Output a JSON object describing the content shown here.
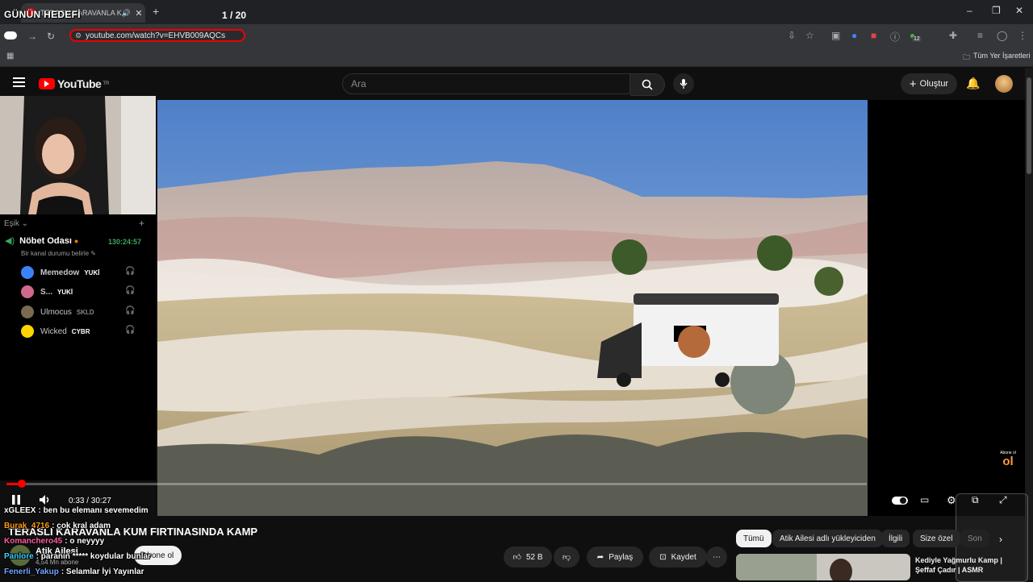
{
  "overlay": {
    "goal_title": "GÜNÜN HEDEFİ",
    "goal_counter": "1 / 20"
  },
  "browser": {
    "tab_title": "TERASLI KARAVANLA KUM",
    "url": "youtube.com/watch?v=EHVB009AQCs",
    "bookmarks_label": "Tüm Yer İşaretleri",
    "ext_badge": "12"
  },
  "youtube": {
    "logo_text": "YouTube",
    "logo_sup": "TR",
    "search_placeholder": "Ara",
    "create_label": "Oluştur"
  },
  "discord": {
    "section_label": "Eşik",
    "channel_name": "Nöbet Odası",
    "timer": "130:24:57",
    "status": "Bir kanal durumu belirle",
    "members": [
      {
        "name": "Memedow",
        "badge": "YUKİ",
        "color": "#3b82f6"
      },
      {
        "name": "S...",
        "badge": "YUKİ",
        "color": "#d06a8a"
      },
      {
        "name": "Ulmocus",
        "badge": "SKLD",
        "color": "#7a6a4f"
      },
      {
        "name": "Wicked",
        "badge": "CYBR",
        "color": "#ffd400"
      }
    ]
  },
  "player": {
    "time": "0:33 / 30:27",
    "progress": 0.018
  },
  "video": {
    "title": "TERASLI KARAVANLA KUM FIRTINASINDA KAMP",
    "channel": "Atik Ailesi",
    "subscribers": "4,54 Mn abone",
    "subscribe_label": "Abone ol",
    "likes": "52 B",
    "share_label": "Paylaş",
    "save_label": "Kaydet"
  },
  "chips": [
    "Tümü",
    "Atik Ailesi adlı yükleyiciden",
    "İlgili",
    "Size özel",
    "Son"
  ],
  "recommendation": {
    "title": "Kediyle Yağmurlu Kamp | Şeffaf Çadır | ASMR"
  },
  "chat": [
    {
      "user": "xGLEEX",
      "text": ": ben bu elemanı sevemedim",
      "color": "#ffffff"
    },
    {
      "user": "Burak_4716",
      "text": ": çok kral adam",
      "color": "#ff9b1a"
    },
    {
      "user": "Komanchero45",
      "text": ": o neyyyy",
      "color": "#ff5fa2"
    },
    {
      "user": "Panlore",
      "text": ": paranın ***** koydular bunlar",
      "color": "#3fd2ff"
    },
    {
      "user": "Fenerli_Yakup",
      "text": ": Selamlar İyi Yayınlar",
      "color": "#6fa8ff"
    }
  ],
  "watermark": {
    "text": "Abone ol"
  }
}
